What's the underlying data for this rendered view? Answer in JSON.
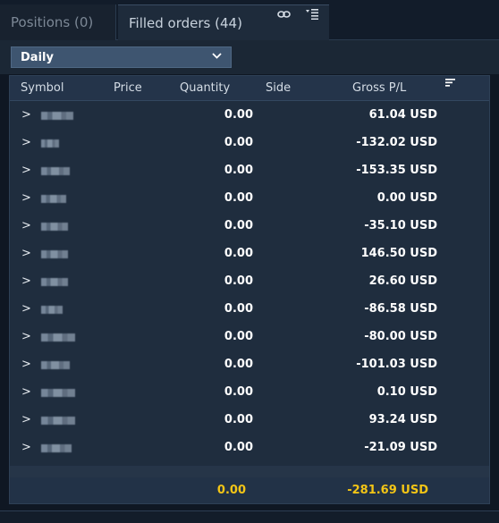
{
  "tabs": [
    {
      "label": "Positions (0)",
      "active": false
    },
    {
      "label": "Filled orders (44)",
      "active": true
    }
  ],
  "tab_icons": [
    "link-icon",
    "menu-icon"
  ],
  "filter": {
    "selected": "Daily"
  },
  "table": {
    "headers": {
      "symbol": "Symbol",
      "price": "Price",
      "quantity": "Quantity",
      "side": "Side",
      "gross": "Gross P/L"
    },
    "rows": [
      {
        "quantity": "0.00",
        "gross_pl": "61.04 USD"
      },
      {
        "quantity": "0.00",
        "gross_pl": "-132.02 USD"
      },
      {
        "quantity": "0.00",
        "gross_pl": "-153.35 USD"
      },
      {
        "quantity": "0.00",
        "gross_pl": "0.00 USD"
      },
      {
        "quantity": "0.00",
        "gross_pl": "-35.10 USD"
      },
      {
        "quantity": "0.00",
        "gross_pl": "146.50 USD"
      },
      {
        "quantity": "0.00",
        "gross_pl": "26.60 USD"
      },
      {
        "quantity": "0.00",
        "gross_pl": "-86.58 USD"
      },
      {
        "quantity": "0.00",
        "gross_pl": "-80.00 USD"
      },
      {
        "quantity": "0.00",
        "gross_pl": "-101.03 USD"
      },
      {
        "quantity": "0.00",
        "gross_pl": "0.10 USD"
      },
      {
        "quantity": "0.00",
        "gross_pl": "93.24 USD"
      },
      {
        "quantity": "0.00",
        "gross_pl": "-21.09 USD"
      }
    ],
    "totals": {
      "quantity": "0.00",
      "gross_pl": "-281.69 USD"
    }
  },
  "colors": {
    "accent": "#2f8cff",
    "totals": "#f3c516",
    "background": "#0f1723"
  }
}
